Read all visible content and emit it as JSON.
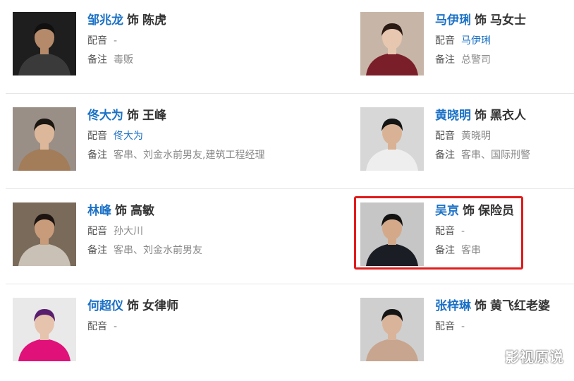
{
  "separator": "饰",
  "labels": {
    "dubbing": "配音",
    "note": "备注"
  },
  "watermark": "影视原说",
  "cast": [
    {
      "actor": "邹兆龙",
      "role": "陈虎",
      "dubbing": "-",
      "dubbing_is_link": false,
      "note": "毒贩",
      "photo_bg": "#1e1e1e",
      "photo_fg": "#3a3a3a",
      "skin": "#b58a6a",
      "hair": "#101010"
    },
    {
      "actor": "马伊琍",
      "role": "马女士",
      "dubbing": "马伊琍",
      "dubbing_is_link": true,
      "note": "总警司",
      "photo_bg": "#c7b6a8",
      "photo_fg": "#7a1e2a",
      "skin": "#e7c7b0",
      "hair": "#2a1a14"
    },
    {
      "actor": "佟大为",
      "role": "王峰",
      "dubbing": "佟大为",
      "dubbing_is_link": true,
      "note": "客串、刘金水前男友,建筑工程经理",
      "photo_bg": "#9a8f86",
      "photo_fg": "#a37c5a",
      "skin": "#dcb79a",
      "hair": "#1a1612"
    },
    {
      "actor": "黄晓明",
      "role": "黑衣人",
      "dubbing": "黄晓明",
      "dubbing_is_link": false,
      "note": "客串、国际刑警",
      "photo_bg": "#d7d7d7",
      "photo_fg": "#eeeeee",
      "skin": "#d9b295",
      "hair": "#141414"
    },
    {
      "actor": "林峰",
      "role": "高敏",
      "dubbing": "孙大川",
      "dubbing_is_link": false,
      "note": "客串、刘金水前男友",
      "photo_bg": "#7a6a5a",
      "photo_fg": "#c9c1b5",
      "skin": "#c89c7a",
      "hair": "#1c1410"
    },
    {
      "actor": "吴京",
      "role": "保险员",
      "dubbing": "-",
      "dubbing_is_link": false,
      "note": "客串",
      "photo_bg": "#c6c6c6",
      "photo_fg": "#1b1d25",
      "skin": "#d3a98a",
      "hair": "#121212"
    },
    {
      "actor": "何超仪",
      "role": "女律师",
      "dubbing": "-",
      "dubbing_is_link": false,
      "note": "",
      "photo_bg": "#e9e9e9",
      "photo_fg": "#e0127a",
      "skin": "#e6c3ad",
      "hair": "#5a1e6e"
    },
    {
      "actor": "张梓琳",
      "role": "黄飞红老婆",
      "dubbing": "-",
      "dubbing_is_link": false,
      "note": "",
      "photo_bg": "#cfcfcf",
      "photo_fg": "#c8a58e",
      "skin": "#d9b49a",
      "hair": "#151515"
    }
  ]
}
